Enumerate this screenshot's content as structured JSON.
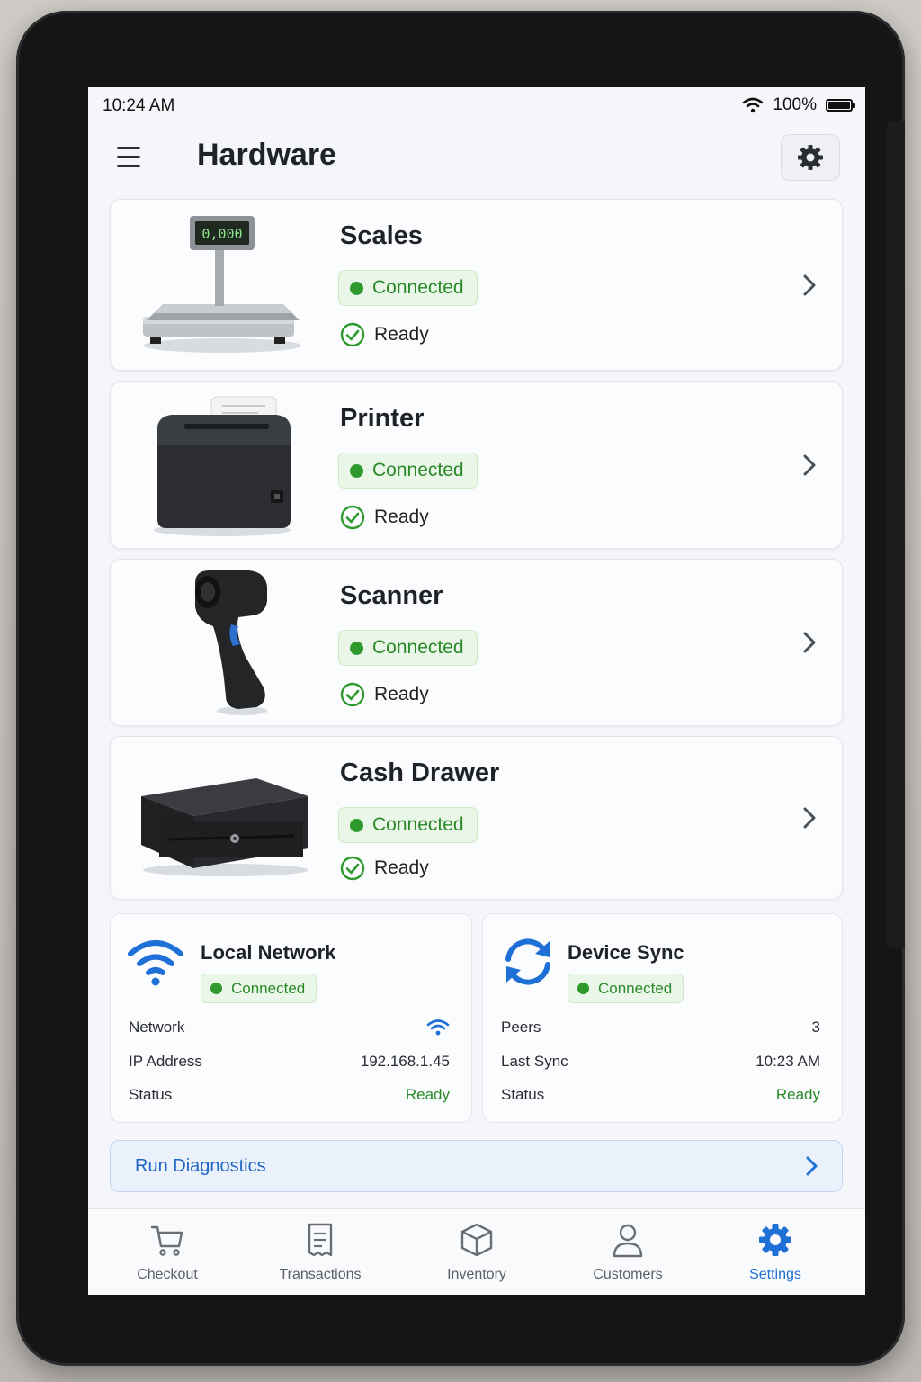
{
  "status_bar": {
    "time": "10:24 AM",
    "battery": "100%"
  },
  "header": {
    "title": "Hardware"
  },
  "devices": [
    {
      "name": "Scales",
      "status": "Connected",
      "state": "Ready"
    },
    {
      "name": "Printer",
      "status": "Connected",
      "state": "Ready"
    },
    {
      "name": "Scanner",
      "status": "Connected",
      "state": "Ready"
    },
    {
      "name": "Cash Drawer",
      "status": "Connected",
      "state": "Ready"
    }
  ],
  "scale_display": "0,000",
  "local_network": {
    "title": "Local Network",
    "status": "Connected",
    "rows": [
      {
        "label": "Network",
        "value": ""
      },
      {
        "label": "IP Address",
        "value": "192.168.1.45"
      },
      {
        "label": "Status",
        "value": "Ready"
      }
    ]
  },
  "device_sync": {
    "title": "Device Sync",
    "status": "Connected",
    "rows": [
      {
        "label": "Peers",
        "value": "3"
      },
      {
        "label": "Last Sync",
        "value": "10:23 AM"
      },
      {
        "label": "Status",
        "value": "Ready"
      }
    ]
  },
  "diagnostics": {
    "label": "Run Diagnostics"
  },
  "tabs": [
    {
      "label": "Checkout",
      "icon": "cart-icon"
    },
    {
      "label": "Transactions",
      "icon": "receipt-icon"
    },
    {
      "label": "Inventory",
      "icon": "box-icon"
    },
    {
      "label": "Customers",
      "icon": "person-icon"
    },
    {
      "label": "Settings",
      "icon": "gear-icon",
      "active": true
    }
  ],
  "colors": {
    "accent": "#1f70d6",
    "success": "#2e9a2e",
    "success_bg": "#eaf6e8"
  }
}
